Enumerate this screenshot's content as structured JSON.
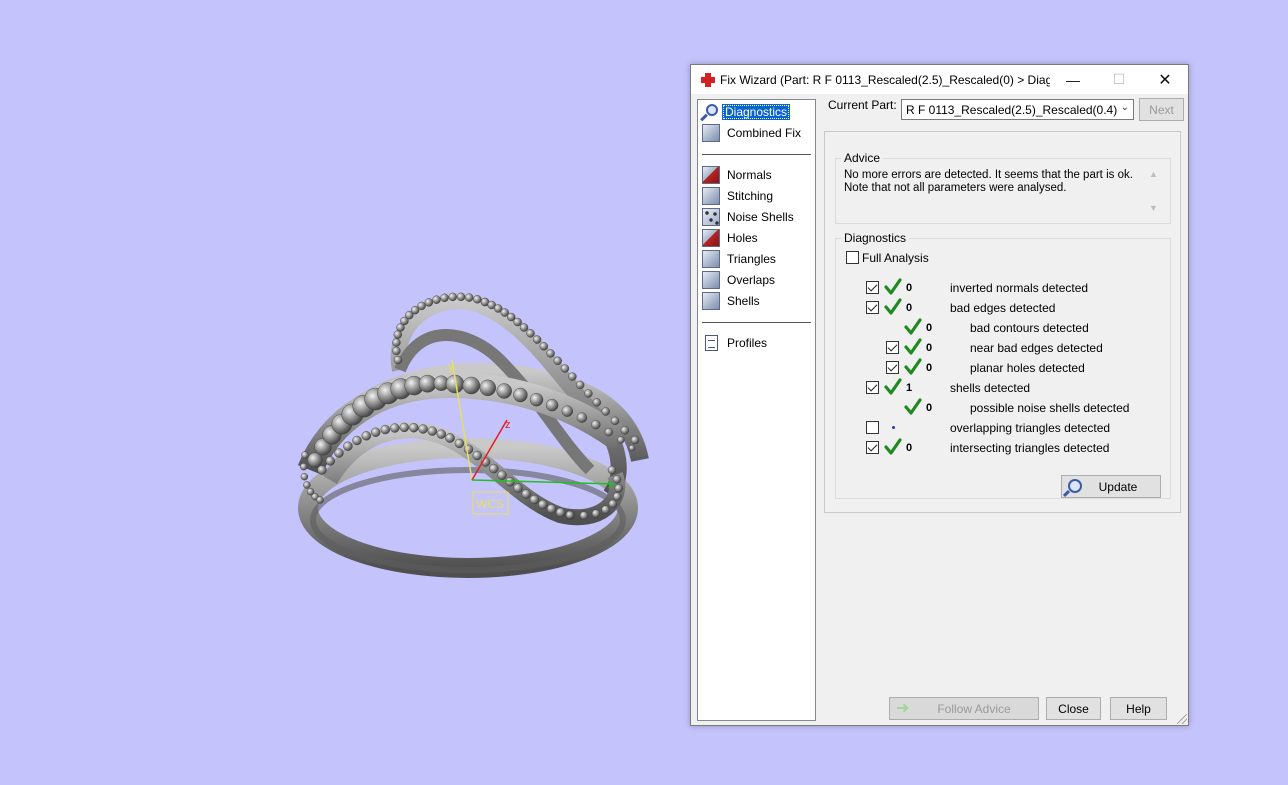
{
  "viewport": {
    "wcs_label": "WCS",
    "axis_x": "x",
    "axis_y": "y",
    "axis_z": "z"
  },
  "dialog": {
    "title": "Fix Wizard (Part: R F 0113_Rescaled(2.5)_Rescaled(0) > Diagn...",
    "window_controls": {
      "minimize": "—",
      "maximize": "☐",
      "close": "✕"
    },
    "nav": {
      "top_items": [
        {
          "label": "Diagnostics",
          "icon": "magnifier-icon",
          "selected": true
        },
        {
          "label": "Combined Fix",
          "icon": "cube-icon"
        }
      ],
      "fix_items": [
        {
          "label": "Normals",
          "icon": "normals-cube-icon"
        },
        {
          "label": "Stitching",
          "icon": "stitching-cube-icon"
        },
        {
          "label": "Noise Shells",
          "icon": "noise-shells-icon"
        },
        {
          "label": "Holes",
          "icon": "holes-cube-icon"
        },
        {
          "label": "Triangles",
          "icon": "triangles-cube-icon"
        },
        {
          "label": "Overlaps",
          "icon": "overlaps-cube-icon"
        },
        {
          "label": "Shells",
          "icon": "shells-cube-icon"
        }
      ],
      "bottom_items": [
        {
          "label": "Profiles",
          "icon": "page-icon"
        }
      ]
    },
    "current_part_label": "Current Part:",
    "current_part_value": "R F 0113_Rescaled(2.5)_Rescaled(0.4)",
    "next_label": "Next",
    "advice": {
      "legend": "Advice",
      "line1": "No more errors are detected. It seems that the part is ok.",
      "line2": "Note that not all parameters were analysed."
    },
    "diagnostics": {
      "legend": "Diagnostics",
      "full_analysis_label": "Full Analysis",
      "full_analysis_checked": false,
      "rows": [
        {
          "checkbox": true,
          "checked": true,
          "status": "ok",
          "value": "0",
          "label": "inverted normals detected",
          "indent": 0
        },
        {
          "checkbox": true,
          "checked": true,
          "status": "ok",
          "value": "0",
          "label": "bad edges detected",
          "indent": 0
        },
        {
          "checkbox": false,
          "checked": false,
          "status": "ok",
          "value": "0",
          "label": "bad contours detected",
          "indent": 1
        },
        {
          "checkbox": true,
          "checked": true,
          "status": "ok",
          "value": "0",
          "label": "near bad edges detected",
          "indent": 1
        },
        {
          "checkbox": true,
          "checked": true,
          "status": "ok",
          "value": "0",
          "label": "planar holes detected",
          "indent": 1
        },
        {
          "checkbox": true,
          "checked": true,
          "status": "ok",
          "value": "1",
          "label": "shells detected",
          "indent": 0
        },
        {
          "checkbox": false,
          "checked": false,
          "status": "ok",
          "value": "0",
          "label": "possible noise shells detected",
          "indent": 1
        },
        {
          "checkbox": true,
          "checked": false,
          "status": "none",
          "value": "",
          "label": "overlapping triangles detected",
          "indent": 0
        },
        {
          "checkbox": true,
          "checked": true,
          "status": "ok",
          "value": "0",
          "label": "intersecting triangles detected",
          "indent": 0
        }
      ],
      "update_label": "Update"
    },
    "buttons": {
      "follow_advice": "Follow Advice",
      "close": "Close",
      "help": "Help"
    }
  },
  "colors": {
    "background": "#c4c3fb",
    "selection": "#0a64d0",
    "ok_check": "#1f8a1f",
    "model_grey": "#8c8c8c"
  }
}
